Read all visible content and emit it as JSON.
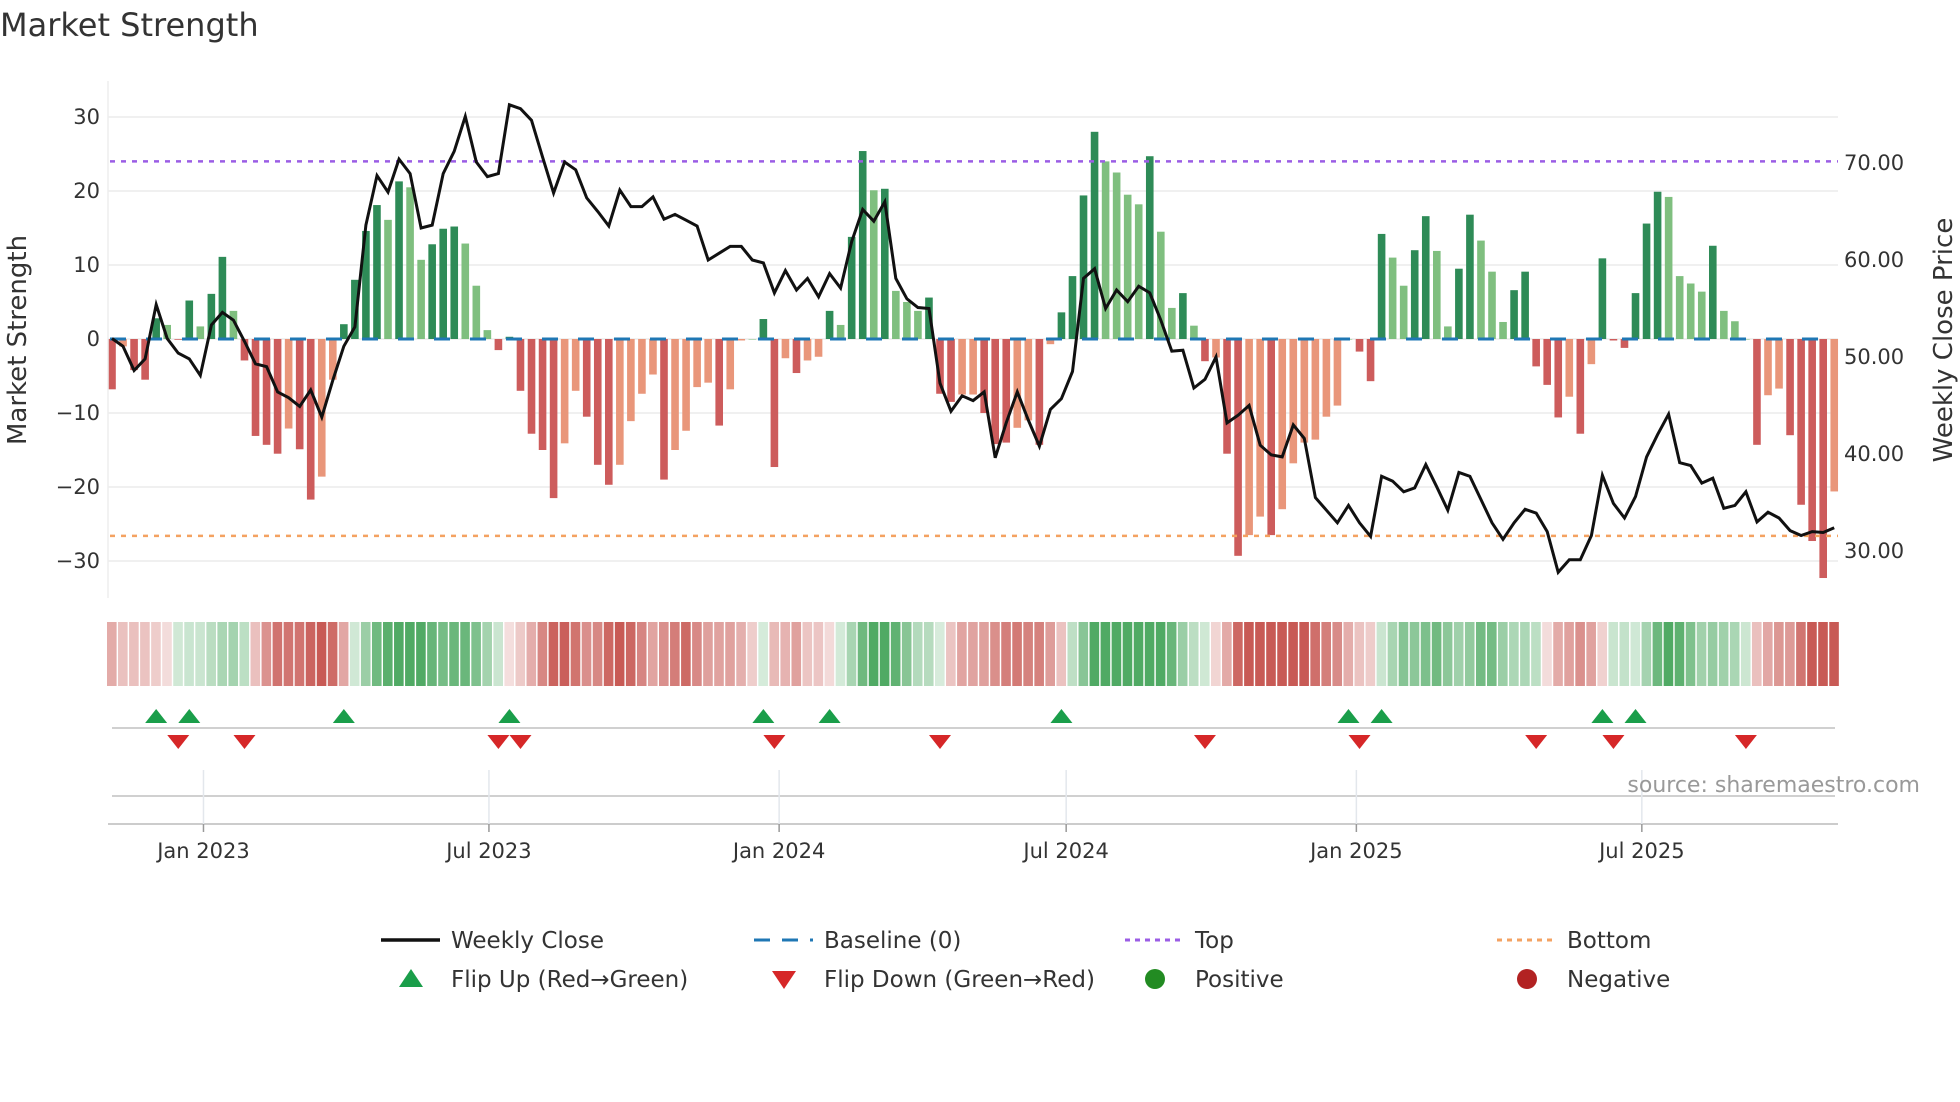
{
  "chart_data": {
    "type": "bar",
    "title": "Market Strength",
    "ylabel": "Market Strength",
    "y2label": "Weekly Close Price",
    "ylim": [
      -35,
      35
    ],
    "y2lim": [
      25.05,
      78.4
    ],
    "yticks": [
      30,
      20,
      10,
      0,
      -10,
      -20,
      -30
    ],
    "ytick_labels": [
      "30",
      "20",
      "10",
      "0",
      "−10",
      "−20",
      "−30"
    ],
    "y2ticks": [
      70,
      60,
      50,
      40,
      30
    ],
    "y2tick_labels": [
      "70.00",
      "60.00",
      "50.00",
      "40.00",
      "30.00"
    ],
    "start_date": "2022-11-04",
    "frequency": "weekly",
    "xticks": [
      {
        "date": "2023-01-01",
        "label": "Jan 2023"
      },
      {
        "date": "2023-07-01",
        "label": "Jul 2023"
      },
      {
        "date": "2024-01-01",
        "label": "Jan 2024"
      },
      {
        "date": "2024-07-01",
        "label": "Jul 2024"
      },
      {
        "date": "2025-01-01",
        "label": "Jan 2025"
      },
      {
        "date": "2025-07-01",
        "label": "Jul 2025"
      }
    ],
    "top_level": 24.0,
    "bottom_level": -26.6,
    "baseline": 0,
    "strength": [
      -6.8,
      -1.0,
      -4.2,
      -5.5,
      2.8,
      1.9,
      -0.1,
      5.2,
      1.7,
      6.1,
      11.1,
      3.8,
      -2.9,
      -13.1,
      -14.3,
      -15.5,
      -12.1,
      -14.9,
      -21.7,
      -18.6,
      -5.5,
      2.0,
      8.0,
      14.6,
      18.1,
      16.1,
      21.3,
      20.5,
      10.7,
      12.8,
      14.9,
      15.2,
      12.9,
      7.2,
      1.2,
      -1.5,
      0.3,
      -7.0,
      -12.8,
      -15.0,
      -21.5,
      -14.1,
      -7.0,
      -10.5,
      -17.0,
      -19.7,
      -17.0,
      -11.1,
      -7.4,
      -4.8,
      -19.0,
      -15.0,
      -12.4,
      -6.5,
      -5.9,
      -11.7,
      -6.8,
      -0.2,
      0.0,
      2.7,
      -17.3,
      -2.6,
      -4.6,
      -2.9,
      -2.4,
      3.8,
      1.9,
      13.8,
      25.4,
      20.1,
      20.3,
      6.5,
      5.0,
      3.8,
      5.6,
      -7.4,
      -8.5,
      -7.5,
      -7.5,
      -10.0,
      -14.2,
      -14.0,
      -12.0,
      -11.0,
      -14.3,
      -0.7,
      3.6,
      8.5,
      19.4,
      28.0,
      24.0,
      22.5,
      19.5,
      18.2,
      24.7,
      14.5,
      4.2,
      6.2,
      1.8,
      -3.0,
      -2.5,
      -15.5,
      -29.3,
      -26.5,
      -24.0,
      -26.5,
      -23.0,
      -16.8,
      -14.0,
      -13.6,
      -10.5,
      -9.0,
      0.0,
      -1.7,
      -5.7,
      14.2,
      11.0,
      7.2,
      12.0,
      16.6,
      11.9,
      1.7,
      9.5,
      16.8,
      13.3,
      9.1,
      2.3,
      6.6,
      9.1,
      -3.7,
      -6.2,
      -10.6,
      -7.8,
      -12.8,
      -3.4,
      10.9,
      -0.2,
      -1.2,
      6.2,
      15.6,
      19.9,
      19.2,
      8.5,
      7.5,
      6.4,
      12.6,
      3.8,
      2.4,
      0.0,
      -14.3,
      -7.6,
      -6.7,
      -13.0,
      -22.4,
      -27.3,
      -32.3,
      -20.6
    ],
    "strong": [
      1,
      0,
      1,
      1,
      1,
      0,
      1,
      1,
      0,
      1,
      1,
      0,
      1,
      1,
      1,
      1,
      0,
      1,
      1,
      0,
      0,
      1,
      1,
      1,
      1,
      0,
      1,
      0,
      0,
      1,
      1,
      1,
      0,
      0,
      0,
      1,
      1,
      1,
      1,
      1,
      1,
      0,
      0,
      1,
      1,
      1,
      0,
      0,
      0,
      0,
      1,
      0,
      0,
      0,
      0,
      1,
      0,
      0,
      0,
      1,
      1,
      0,
      1,
      0,
      0,
      1,
      0,
      1,
      1,
      0,
      1,
      0,
      0,
      0,
      1,
      1,
      1,
      0,
      0,
      1,
      1,
      1,
      0,
      0,
      1,
      0,
      1,
      1,
      1,
      1,
      0,
      0,
      0,
      0,
      1,
      0,
      0,
      1,
      0,
      1,
      0,
      1,
      1,
      0,
      0,
      1,
      0,
      0,
      0,
      0,
      0,
      0,
      0,
      1,
      1,
      1,
      0,
      0,
      1,
      1,
      0,
      0,
      1,
      1,
      0,
      0,
      0,
      1,
      1,
      1,
      1,
      1,
      0,
      1,
      0,
      1,
      1,
      1,
      1,
      1,
      1,
      0,
      0,
      0,
      0,
      1,
      0,
      0,
      0,
      1,
      0,
      0,
      1,
      1,
      1,
      1,
      0
    ],
    "weekly_close": [
      51.8,
      51.0,
      48.5,
      49.7,
      55.3,
      51.8,
      50.3,
      49.7,
      48.0,
      53.2,
      54.5,
      53.7,
      51.5,
      49.2,
      48.9,
      46.3,
      45.7,
      44.8,
      46.5,
      43.7,
      47.5,
      51.0,
      53.0,
      63.5,
      68.6,
      66.9,
      70.3,
      68.8,
      63.2,
      63.5,
      68.8,
      71.1,
      74.7,
      70.0,
      68.5,
      68.8,
      75.9,
      75.5,
      74.3,
      70.5,
      66.8,
      70.0,
      69.2,
      66.3,
      64.9,
      63.4,
      67.1,
      65.4,
      65.4,
      66.4,
      64.1,
      64.6,
      64.0,
      63.4,
      59.9,
      60.6,
      61.3,
      61.3,
      59.9,
      59.6,
      56.5,
      58.8,
      56.8,
      58.0,
      56.1,
      58.5,
      57.0,
      61.8,
      65.1,
      63.9,
      65.9,
      58.0,
      55.9,
      55.0,
      54.9,
      47.2,
      44.3,
      45.9,
      45.4,
      46.3,
      39.5,
      43.1,
      46.3,
      43.4,
      40.7,
      44.5,
      45.6,
      48.4,
      58.0,
      59.0,
      54.9,
      56.8,
      55.6,
      57.2,
      56.5,
      53.7,
      50.5,
      50.6,
      46.7,
      47.6,
      49.9,
      43.1,
      43.9,
      44.9,
      40.8,
      39.8,
      39.6,
      42.9,
      41.5,
      35.4,
      34.1,
      32.8,
      34.6,
      32.8,
      31.4,
      37.6,
      37.1,
      36.0,
      36.4,
      38.8,
      36.5,
      34.1,
      38.0,
      37.6,
      35.2,
      32.8,
      31.1,
      32.8,
      34.2,
      33.8,
      31.9,
      27.7,
      29.0,
      29.0,
      31.5,
      37.7,
      34.8,
      33.3,
      35.5,
      39.6,
      41.9,
      44.0,
      39.0,
      38.7,
      36.9,
      37.4,
      34.3,
      34.6,
      36.0,
      32.9,
      33.9,
      33.3,
      32.0,
      31.5,
      31.9,
      31.8,
      32.3
    ],
    "flip_up_weeks": [
      5,
      8,
      22,
      37,
      60,
      66,
      87,
      113,
      116,
      136,
      139
    ],
    "flip_down_weeks": [
      7,
      13,
      36,
      38,
      61,
      76,
      100,
      114,
      130,
      137,
      149
    ],
    "legend": [
      {
        "label": "Weekly Close",
        "kind": "line",
        "color": "#111111"
      },
      {
        "label": "Baseline (0)",
        "kind": "dash",
        "color": "#1f77b4"
      },
      {
        "label": "Top",
        "kind": "dot",
        "color": "#9b5de5"
      },
      {
        "label": "Bottom",
        "kind": "dot",
        "color": "#f4a261"
      },
      {
        "label": "Flip Up (Red→Green)",
        "kind": "tri-up",
        "color": "#1a9e4a"
      },
      {
        "label": "Flip Down (Green→Red)",
        "kind": "tri-down",
        "color": "#d62728"
      },
      {
        "label": "Positive",
        "kind": "circle",
        "color": "#228b22"
      },
      {
        "label": "Negative",
        "kind": "circle",
        "color": "#b22222"
      }
    ],
    "legend_position": "bottom",
    "grid": true
  },
  "colors": {
    "pos_strong": "#2e8b57",
    "pos_weak": "#7fbf7f",
    "neg_strong": "#cd5c5c",
    "neg_weak": "#e9967a"
  },
  "source": "source: sharemaestro.com"
}
